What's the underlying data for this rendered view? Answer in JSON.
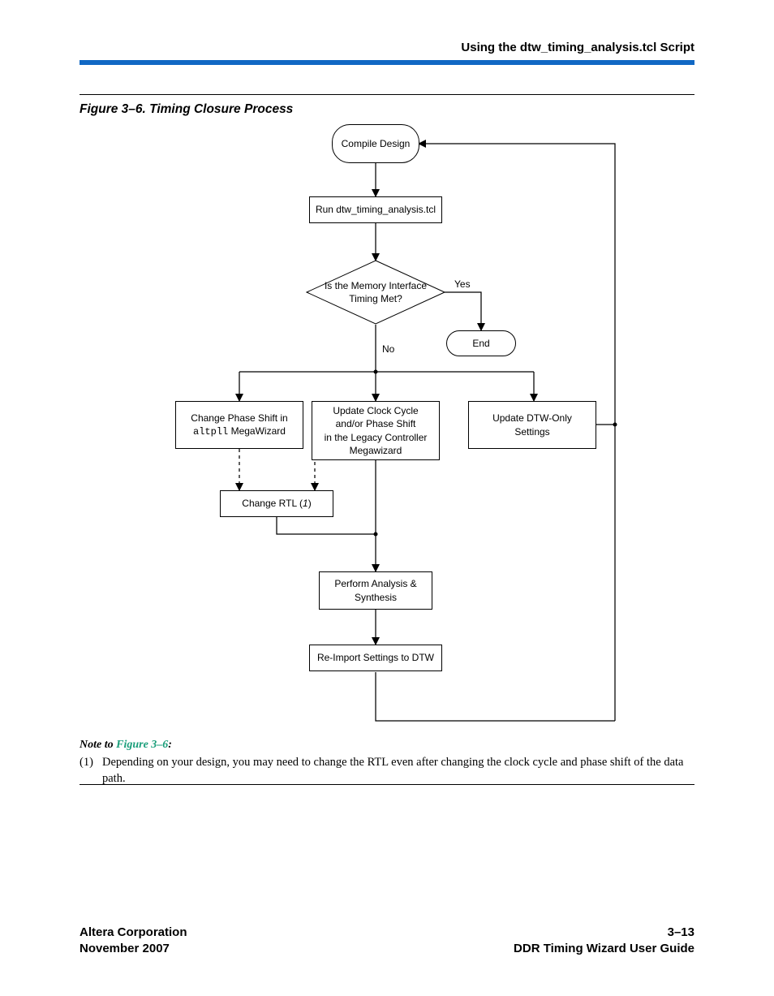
{
  "header": {
    "title": "Using the dtw_timing_analysis.tcl Script"
  },
  "figure": {
    "caption": "Figure 3–6. Timing Closure Process"
  },
  "chart_data": {
    "type": "flowchart",
    "nodes": [
      {
        "id": "compile",
        "type": "terminator",
        "label": "Compile Design"
      },
      {
        "id": "run",
        "type": "process",
        "label": "Run dtw_timing_analysis.tcl"
      },
      {
        "id": "decision",
        "type": "decision",
        "label": "Is the Memory Interface\nTiming Met?"
      },
      {
        "id": "end",
        "type": "terminator",
        "label": "End"
      },
      {
        "id": "phase",
        "type": "process",
        "label": "Change Phase Shift in\naltpll MegaWizard",
        "mono_segment": "altpll"
      },
      {
        "id": "update",
        "type": "process",
        "label": "Update Clock Cycle\nand/or Phase Shift\nin the Legacy Controller\nMegawizard"
      },
      {
        "id": "dtwonly",
        "type": "process",
        "label": "Update DTW-Only\nSettings"
      },
      {
        "id": "rtl",
        "type": "process",
        "label": "Change RTL (1)",
        "italic_segment": "1"
      },
      {
        "id": "synth",
        "type": "process",
        "label": "Perform Analysis &\nSynthesis"
      },
      {
        "id": "reimport",
        "type": "process",
        "label": "Re-Import Settings to DTW"
      }
    ],
    "edges": [
      {
        "from": "compile",
        "to": "run"
      },
      {
        "from": "run",
        "to": "decision"
      },
      {
        "from": "decision",
        "to": "end",
        "label": "Yes"
      },
      {
        "from": "decision",
        "to": "update",
        "label": "No",
        "branch_to": [
          "phase",
          "dtwonly"
        ]
      },
      {
        "from": "phase",
        "to": "rtl",
        "style": "dashed"
      },
      {
        "from": "update",
        "to": "rtl",
        "style": "dashed"
      },
      {
        "from": "rtl",
        "to": "synth"
      },
      {
        "from": "update",
        "to": "synth"
      },
      {
        "from": "synth",
        "to": "reimport"
      },
      {
        "from": "reimport",
        "to": "compile",
        "style": "loop-right"
      },
      {
        "from": "dtwonly",
        "to": "reimport",
        "style": "loop-right"
      }
    ],
    "edge_labels": {
      "yes": "Yes",
      "no": "No"
    }
  },
  "note": {
    "heading_prefix": "Note to ",
    "heading_link": "Figure 3–6",
    "heading_suffix": ":",
    "index": "(1)",
    "text": "Depending on your design, you may need to change the RTL even after changing the clock cycle and phase shift of the data path."
  },
  "footer": {
    "left_line1": "Altera Corporation",
    "left_line2": "November 2007",
    "right_line1": "3–13",
    "right_line2": "DDR Timing Wizard User Guide"
  }
}
